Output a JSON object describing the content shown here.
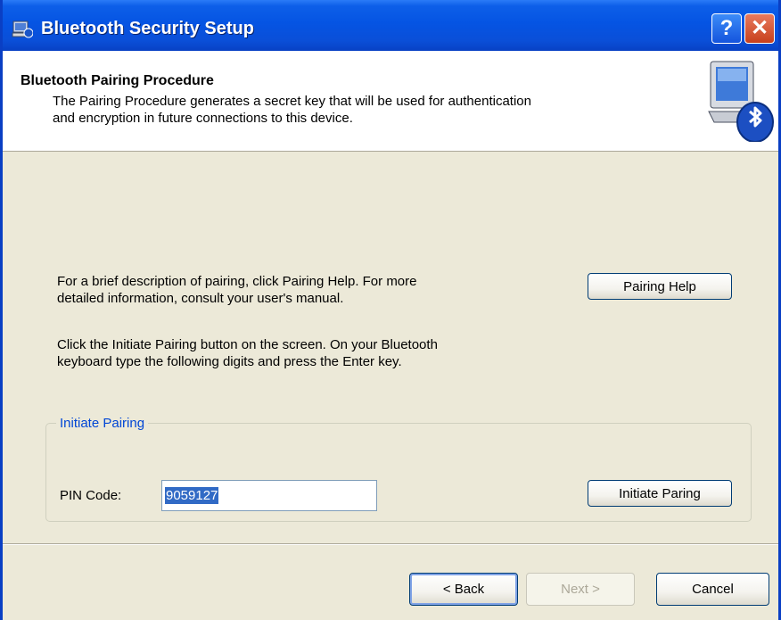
{
  "window": {
    "title": "Bluetooth Security Setup",
    "help_label": "?",
    "close_label": "✕"
  },
  "header": {
    "title": "Bluetooth Pairing Procedure",
    "description_line1": "The Pairing Procedure generates a secret key that will be used for authentication",
    "description_line2": "and encryption in future connections to this device."
  },
  "body": {
    "help_text_line1": "For a brief description of pairing, click Pairing Help.  For more",
    "help_text_line2": "detailed information, consult your user's manual.",
    "pairing_help_label": "Pairing Help",
    "instruction_line1": "Click the Initiate Pairing button on the screen.  On your Bluetooth",
    "instruction_line2": "keyboard type the following digits and press the Enter key."
  },
  "group": {
    "label": "Initiate Pairing",
    "pin_label": "PIN Code:",
    "pin_value": "9059127",
    "initiate_label": "Initiate Paring"
  },
  "footer": {
    "back_label": "< Back",
    "next_label": "Next >",
    "cancel_label": "Cancel"
  }
}
